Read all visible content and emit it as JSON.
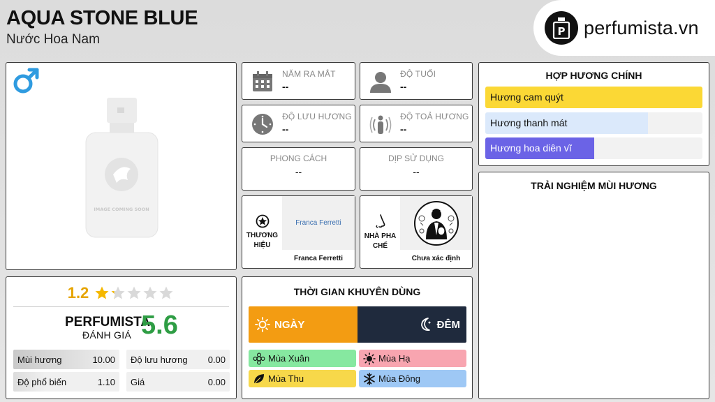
{
  "header": {
    "title": "AQUA STONE BLUE",
    "subtitle": "Nước Hoa Nam"
  },
  "logo": {
    "text": "perfumista.vn",
    "icon": "perfume-bottle-logo"
  },
  "image": {
    "placeholder_text": "IMAGE COMING SOON",
    "gender_icon": "male-icon"
  },
  "rating": {
    "score": "1.2",
    "stars": 1.2,
    "max_stars": 5,
    "brand": "PERFUMISTA",
    "brand_label": "ĐÁNH GIÁ",
    "brand_score": "5.6",
    "metrics": [
      {
        "label": "Mùi hương",
        "value": "10.00"
      },
      {
        "label": "Độ lưu hương",
        "value": "0.00"
      },
      {
        "label": "Độ phổ biến",
        "value": "1.10"
      },
      {
        "label": "Giá",
        "value": "0.00"
      }
    ]
  },
  "info": {
    "launch": {
      "label": "NĂM RA MẮT",
      "value": "--",
      "icon": "calendar-icon"
    },
    "age": {
      "label": "ĐỘ TUỔI",
      "value": "--",
      "icon": "person-icon"
    },
    "longevity": {
      "label": "ĐỘ LƯU HƯƠNG",
      "value": "--",
      "icon": "clock-icon"
    },
    "sillage": {
      "label": "ĐỘ TOẢ HƯƠNG",
      "value": "--",
      "icon": "sillage-icon"
    },
    "style": {
      "label": "PHONG CÁCH",
      "value": "--"
    },
    "occasion": {
      "label": "DỊP SỬ DỤNG",
      "value": "--"
    }
  },
  "brand_card": {
    "label_line1": "THƯƠNG",
    "label_line2": "HIỆU",
    "logo_text": "Franca Ferretti",
    "caption": "Franca Ferretti",
    "icon": "star-badge-icon"
  },
  "perfumer_card": {
    "label_line1": "NHÀ PHA",
    "label_line2": "CHẾ",
    "caption": "Chưa xác định",
    "icon": "nose-icon"
  },
  "time": {
    "title": "THỜI GIAN KHUYÊN DÙNG",
    "day": "NGÀY",
    "night": "ĐÊM",
    "seasons": [
      {
        "label": "Mùa Xuân",
        "color": "#86e8a0",
        "icon": "spring-icon"
      },
      {
        "label": "Mùa Hạ",
        "color": "#f8a5b0",
        "icon": "summer-icon"
      },
      {
        "label": "Mùa Thu",
        "color": "#f7d84a",
        "icon": "autumn-leaf-icon"
      },
      {
        "label": "Mùa Đông",
        "color": "#9ec8f5",
        "icon": "snowflake-icon"
      }
    ]
  },
  "accords": {
    "title": "HỢP HƯƠNG CHÍNH",
    "items": [
      {
        "label": "Hương cam quýt",
        "level": 1.0,
        "color": "#fbd835",
        "text_color": "#111111"
      },
      {
        "label": "Hương thanh mát",
        "level": 0.75,
        "color": "#dbe9fb",
        "text_color": "#111111"
      },
      {
        "label": "Hương hoa diên vĩ",
        "level": 0.5,
        "color": "#6b63e6",
        "text_color": "#ffffff"
      }
    ]
  },
  "experience": {
    "title": "TRẢI NGHIỆM MÙI HƯƠNG"
  }
}
